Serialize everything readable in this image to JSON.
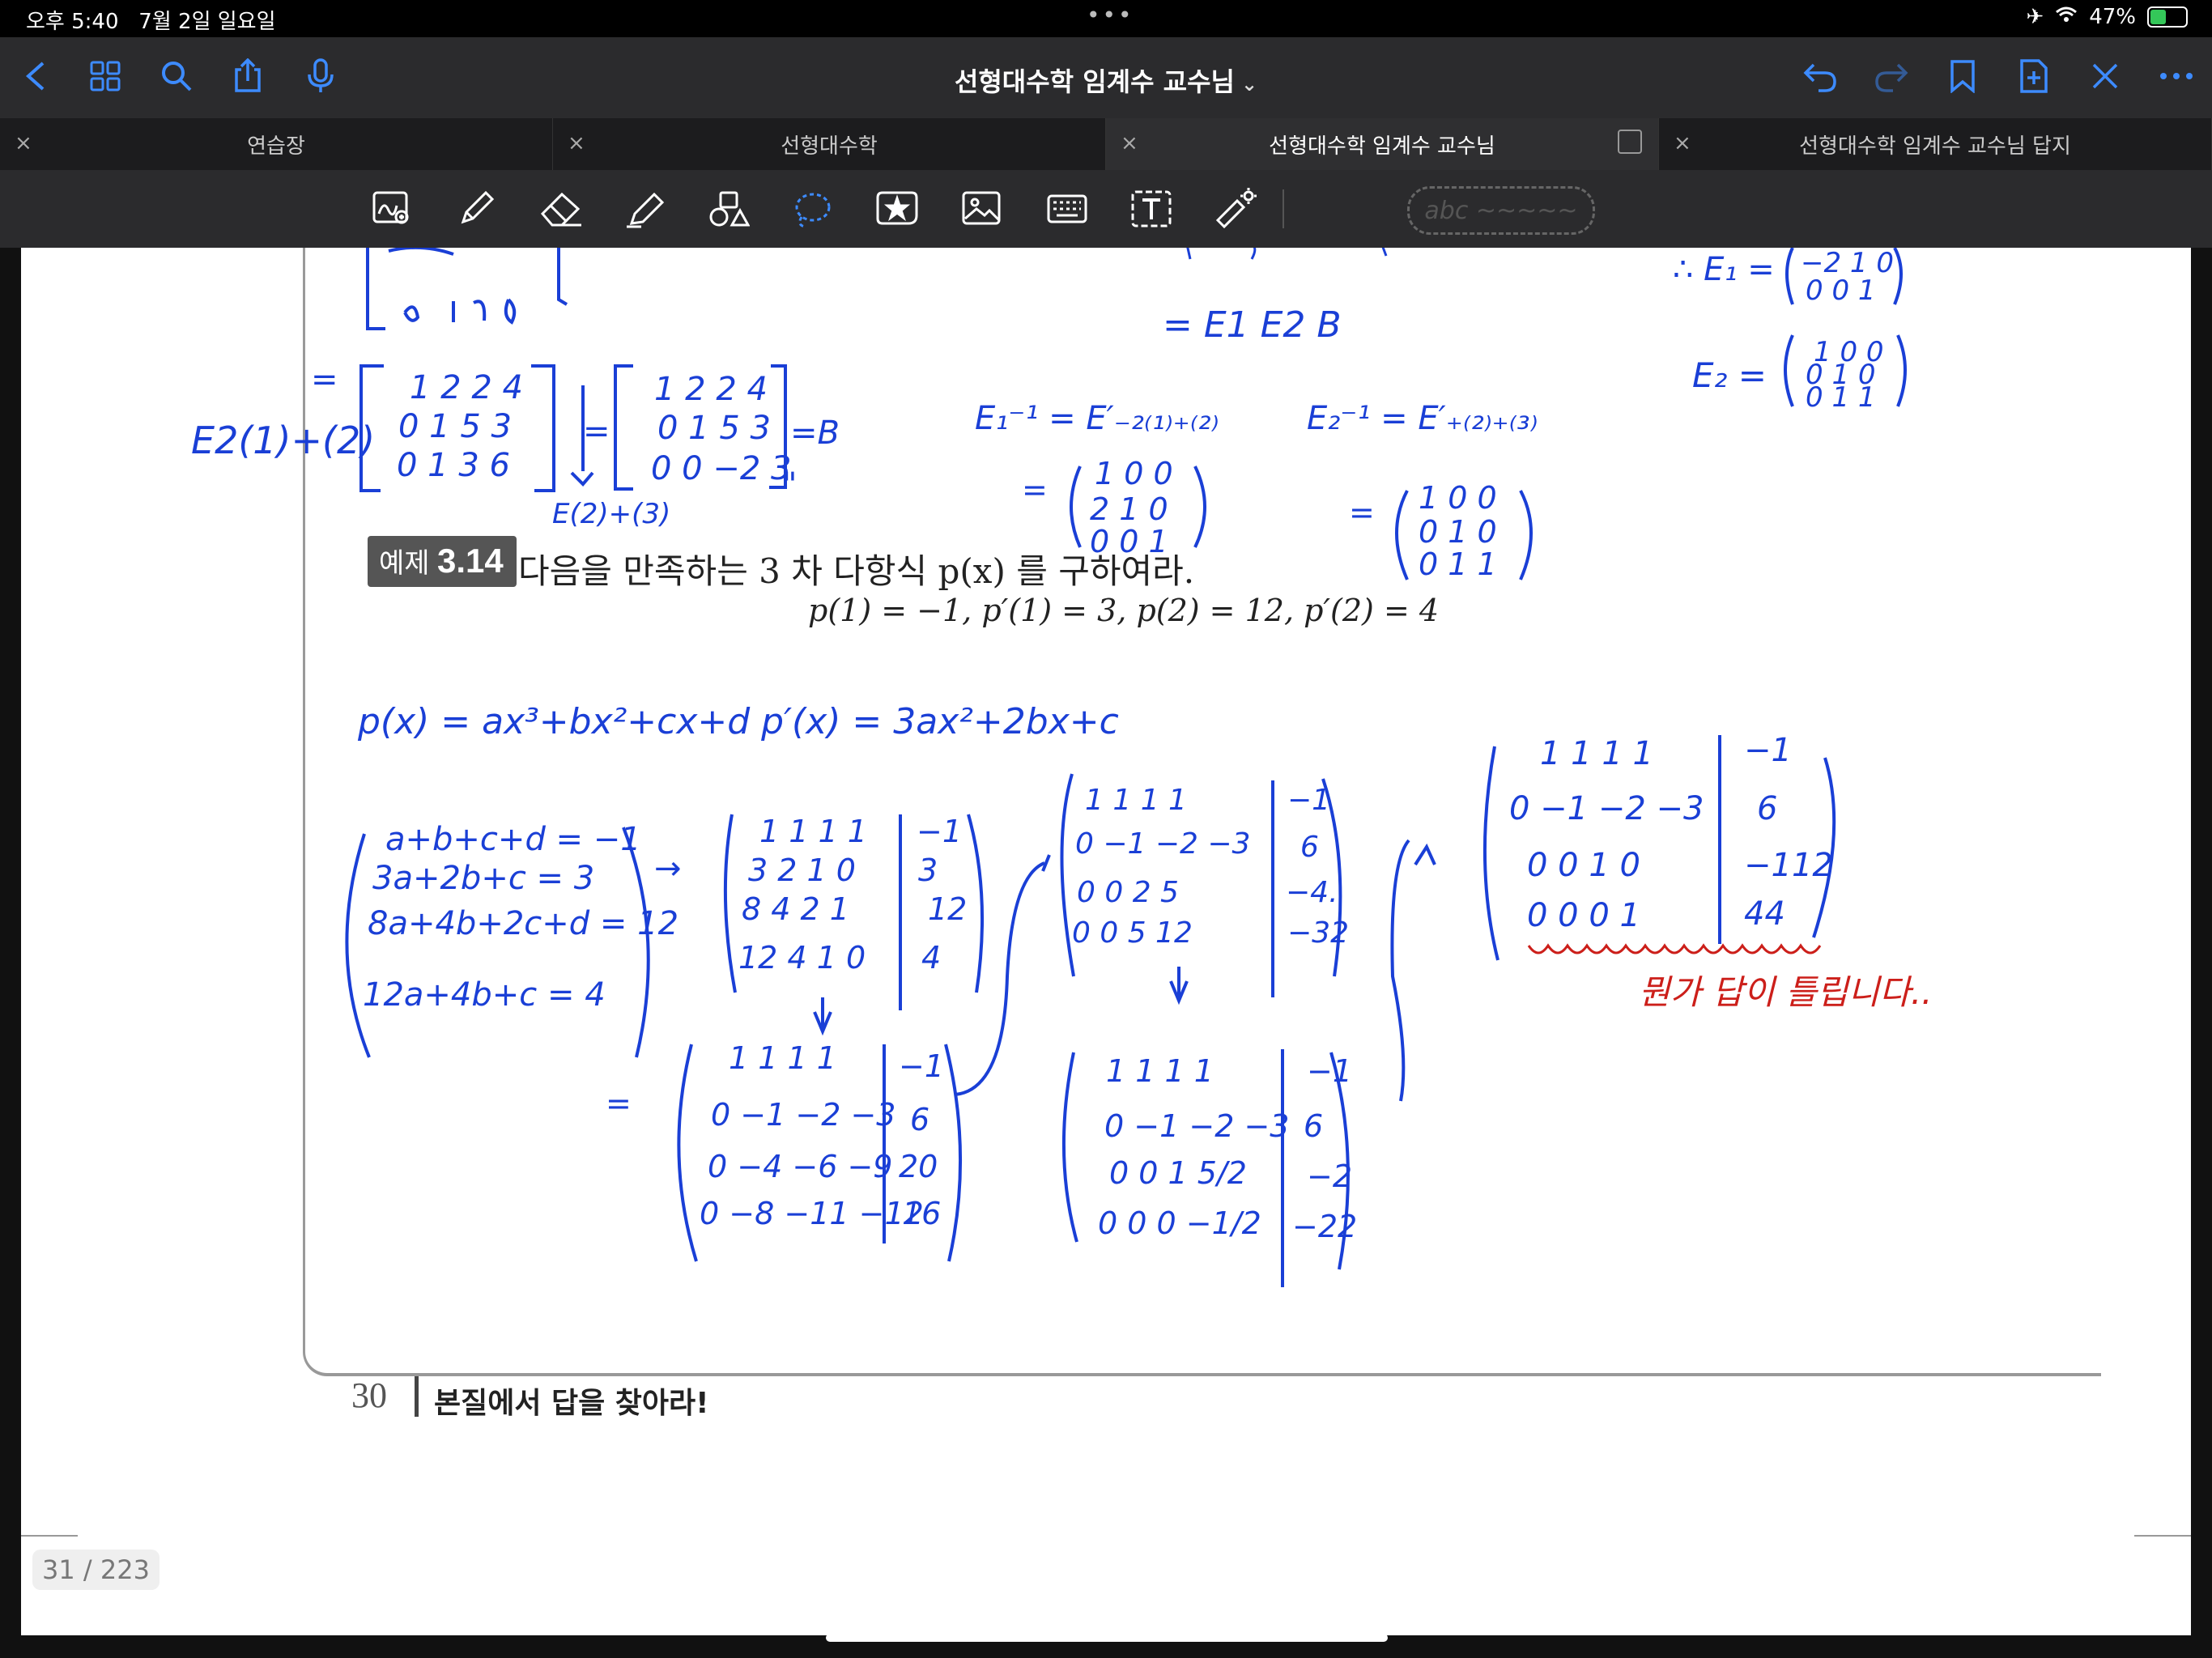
{
  "status": {
    "time": "오후 5:40",
    "date": "7월 2일 일요일",
    "dots": "•••",
    "battery": "47%",
    "battery_level": 0.47
  },
  "nav": {
    "title": "선형대수학 임계수 교수님",
    "title_chevron": "⌄"
  },
  "tabs": [
    {
      "label": "연습장",
      "active": false
    },
    {
      "label": "선형대수학",
      "active": false
    },
    {
      "label": "선형대수학 임계수 교수님",
      "active": true
    },
    {
      "label": "선형대수학 임계수 교수님 답지",
      "active": false
    }
  ],
  "toolbar": {
    "pen_preview": "abc ~~~~~"
  },
  "document": {
    "example_label": "예제",
    "example_number": "3.14",
    "example_text": "다음을 만족하는 3 차 다항식 p(x) 를 구하여라.",
    "example_equation": "p(1) = −1,  p′(1) = 3,  p(2) = 12,  p′(2) = 4",
    "page_number": "30",
    "page_footer": "본질에서 답을 찾아라!"
  },
  "ink": {
    "blue": "#1a3fd6",
    "red": "#cc1f1a",
    "lines": [
      "E2(1)+(2)",
      "= [1 2 2 4 / 0 1 5 3 / 0 1 3 6] → [1 2 2 4 / 0 1 5 3 / 0 0 −2 3] = B",
      "E(2)+(3)",
      "= E1 E2 B",
      "E1⁻¹ = E′−2(1)+(2) = (1 0 0 / 2 1 0 / 0 0 1)",
      "E2⁻¹ = E′+(2)+(3) = (1 0 0 / 0 1 0 / 0 1 1)",
      "∴ E1 = (−2 1 0 / 0 0 1)",
      "E2 = (1 0 0 / 0 1 0 / 0 1 1)",
      "p(x) = ax³+bx²+cx+d     p′(x) = 3ax²+2bx+c",
      "a+b+c+d = −1",
      "3a+2b+c = 3",
      "8a+4b+2c+d = 12",
      "12a+4b+c = 4",
      "1 1 1 1 | −1 / 3 2 1 0 | 3 / 8 4 2 1 | 12 / 12 4 1 0 | 4",
      "1 1 1 1 | −1 / 0 −1 −2 −3 | 6 / 0 −4 −6 −9 | 20 / 0 −8 −11 −12 | 16",
      "1 1 1 1 | −1 / 0 −1 −2 −3 | 6 / 0 0 2 5 | −4 / 0 0 5 12 | −32",
      "1 1 1 1 | −1 / 0 −1 −2 −3 | 6 / 0 0 1 5/2 | −2 / 0 0 0 −1/2 | −22",
      "1 1 1 1 | −1 / 0 −1 −2 −3 | 6 / 0 0 1 0 | −112 / 0 0 0 1 | 44",
      "뭔가 답이 틀립니다.."
    ]
  },
  "viewer": {
    "page_indicator": "31 / 223"
  }
}
